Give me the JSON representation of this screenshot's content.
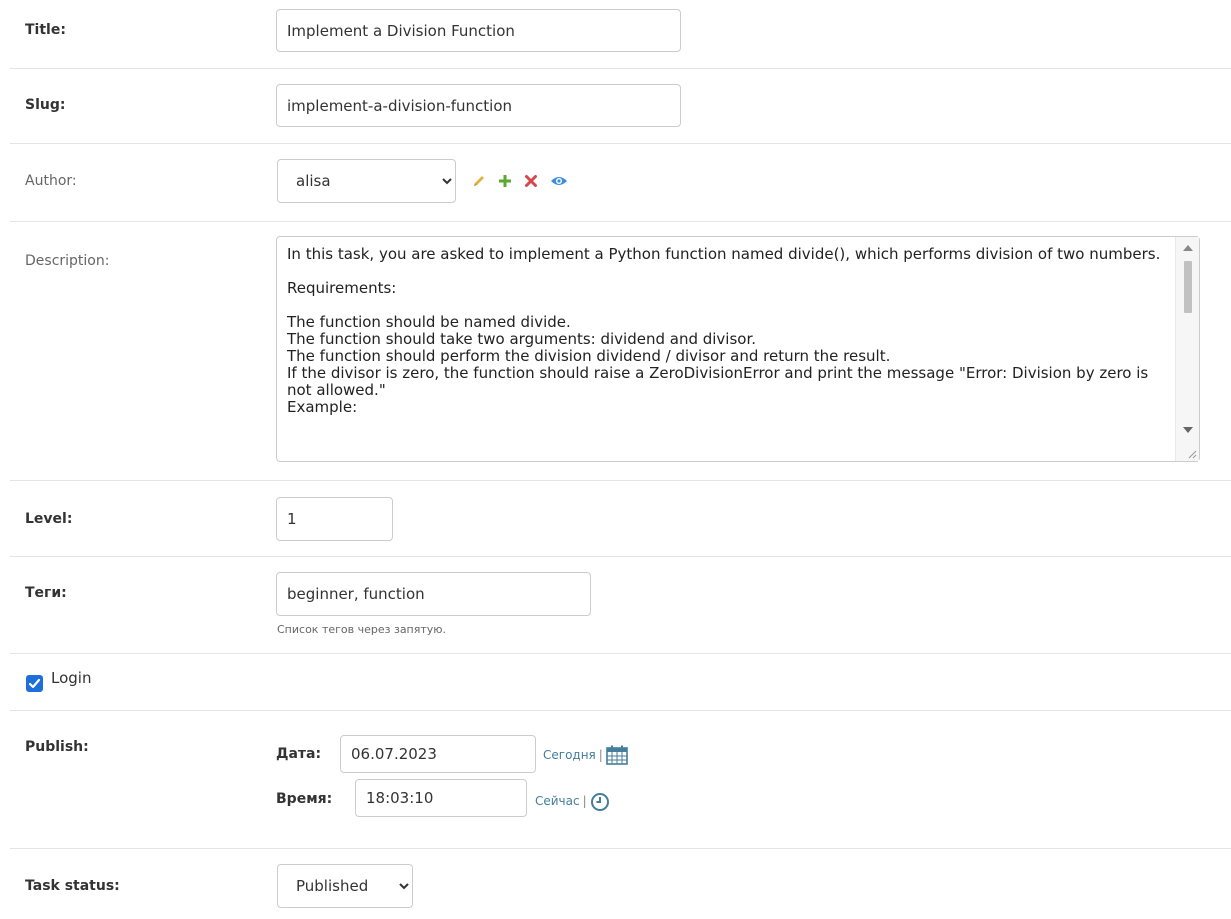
{
  "fields": {
    "title": {
      "label": "Title:",
      "value": "Implement a Division Function"
    },
    "slug": {
      "label": "Slug:",
      "value": "implement-a-division-function"
    },
    "author": {
      "label": "Author:",
      "value": "alisa"
    },
    "description": {
      "label": "Description:",
      "value": "In this task, you are asked to implement a Python function named divide(), which performs division of two numbers.\n\nRequirements:\n\nThe function should be named divide.\nThe function should take two arguments: dividend and divisor.\nThe function should perform the division dividend / divisor and return the result.\nIf the divisor is zero, the function should raise a ZeroDivisionError and print the message \"Error: Division by zero is not allowed.\"\nExample:"
    },
    "level": {
      "label": "Level:",
      "value": "1"
    },
    "tags": {
      "label": "Теги:",
      "value": "beginner, function",
      "help": "Список тегов через запятую."
    },
    "login": {
      "label": "Login",
      "checked": true
    },
    "publish": {
      "label": "Publish:",
      "date_label": "Дата:",
      "date_value": "06.07.2023",
      "today_link": "Сегодня",
      "time_label": "Время:",
      "time_value": "18:03:10",
      "now_link": "Сейчас",
      "separator": "|"
    },
    "task_status": {
      "label": "Task status:",
      "value": "Published"
    }
  },
  "icons": {
    "edit": "pencil-icon",
    "add": "plus-icon",
    "delete": "x-icon",
    "view": "eye-icon",
    "calendar": "calendar-icon",
    "clock": "clock-icon"
  },
  "colors": {
    "edit": "#e2b33b",
    "add": "#5aa832",
    "delete": "#d9464a",
    "view": "#3d8edc",
    "link": "#447e9b",
    "checkbox": "#1e6fd9"
  }
}
